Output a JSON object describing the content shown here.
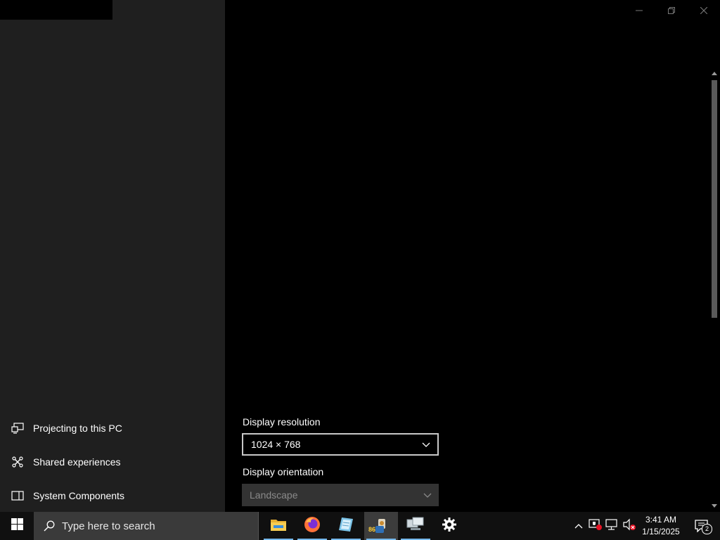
{
  "window": {
    "minimize_icon": "minimize-icon",
    "maximize_icon": "restore-icon",
    "close_icon": "close-icon"
  },
  "sidebar": {
    "items": [
      {
        "label": "Projecting to this PC",
        "icon": "projecting-icon"
      },
      {
        "label": "Shared experiences",
        "icon": "shared-experiences-icon"
      },
      {
        "label": "System Components",
        "icon": "system-components-icon"
      }
    ]
  },
  "display": {
    "resolution_label": "Display resolution",
    "resolution_value": "1024 × 768",
    "orientation_label": "Display orientation",
    "orientation_value": "Landscape"
  },
  "taskbar": {
    "search_placeholder": "Type here to search",
    "apps": [
      {
        "name": "File Explorer",
        "icon": "folder-icon"
      },
      {
        "name": "Firefox",
        "icon": "firefox-icon"
      },
      {
        "name": "Notepad",
        "icon": "notepad-icon"
      },
      {
        "name": "App",
        "icon": "app-icon",
        "badge": "86"
      },
      {
        "name": "Network",
        "icon": "network-icon"
      },
      {
        "name": "Settings",
        "icon": "gear-icon"
      }
    ],
    "clock_time": "3:41 AM",
    "clock_date": "1/15/2025",
    "notification_count": "2"
  },
  "colors": {
    "sidebar_bg": "#1f1f1f",
    "taskbar_bg": "#101010",
    "accent": "#76b9ed"
  }
}
